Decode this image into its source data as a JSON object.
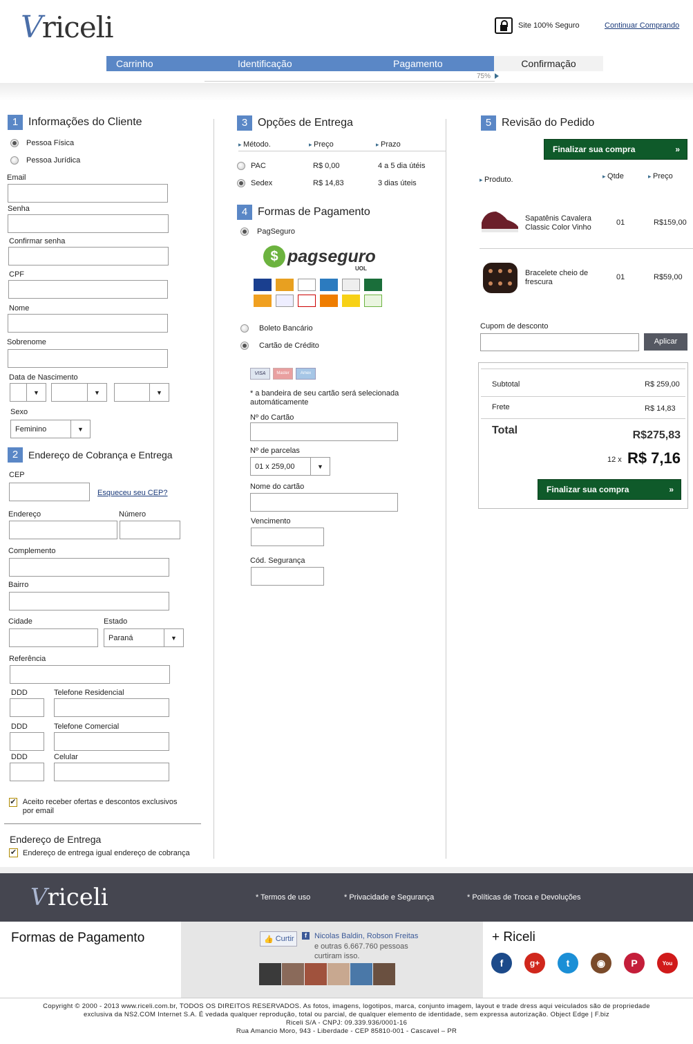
{
  "header": {
    "logo_text": "riceli",
    "secure_text": "Site 100% Seguro",
    "continue_link": "Continuar Comprando"
  },
  "steps": [
    "Carrinho",
    "Identificação",
    "Pagamento",
    "Confirmação"
  ],
  "progress": {
    "label": "75%",
    "value": 0.75
  },
  "client": {
    "num": "1",
    "title": "Informações do Cliente",
    "person_types": [
      "Pessoa Física",
      "Pessoa Jurídica"
    ],
    "person_selected": "Pessoa Física",
    "email": "Email",
    "password": "Senha",
    "confirm": "Confirmar senha",
    "cpf": "CPF",
    "name": "Nome",
    "surname": "Sobrenome",
    "birth": "Data de Nascimento",
    "sex": "Sexo",
    "sex_value": "Feminino"
  },
  "address": {
    "num": "2",
    "title": "Endereço de Cobrança e Entrega",
    "cep": "CEP",
    "forgot_cep": "Esqueceu seu CEP?",
    "street": "Endereço",
    "number": "Número",
    "complement": "Complemento",
    "district": "Bairro",
    "city": "Cidade",
    "state": "Estado",
    "state_value": "Paraná",
    "reference": "Referência",
    "ddd1": "DDD",
    "phone_home": "Telefone Residencial",
    "ddd2": "DDD",
    "phone_work": "Telefone Comercial",
    "ddd3": "DDD",
    "mobile": "Celular",
    "offers": "Aceito receber ofertas e descontos exclusivos por email",
    "delivery_title": "Endereço de Entrega",
    "delivery_same": "Endereço de entrega igual endereço de cobrança"
  },
  "shipping": {
    "num": "3",
    "title": "Opções de Entrega",
    "headers": [
      "Método.",
      "Preço",
      "Prazo"
    ],
    "rows": [
      {
        "method": "PAC",
        "price": "R$ 0,00",
        "time": "4 a 5 dia útéis",
        "selected": false
      },
      {
        "method": "Sedex",
        "price": "R$ 14,83",
        "time": "3 dias úteis",
        "selected": true
      }
    ]
  },
  "payment": {
    "num": "4",
    "title": "Formas de Pagamento",
    "options": [
      "PagSeguro",
      "Boleto Bancário",
      "Cartão de Crédito"
    ],
    "pagseguro_logo": "pagseguro",
    "pagseguro_sub": "UOL",
    "card_note": "* a bandeira de seu cartão será selecionada automáticamente",
    "card_number": "Nº do Cartão",
    "installments": "Nº de parcelas",
    "installments_value": "01 x 259,00",
    "card_name": "Nome do cartão",
    "expiry": "Vencimento",
    "cvv": "Cód. Segurança",
    "card_brands": [
      "VISA",
      "Master",
      "Amex"
    ]
  },
  "review": {
    "num": "5",
    "title": "Revisão do Pedido",
    "finish": "Finalizar sua compra",
    "headers": [
      "Produto.",
      "Qtde",
      "Preço"
    ],
    "items": [
      {
        "name": "Sapatênis Cavalera Classic Color Vinho",
        "qty": "01",
        "price": "R$159,00"
      },
      {
        "name": "Bracelete cheio de frescura",
        "qty": "01",
        "price": "R$59,00"
      }
    ],
    "coupon": "Cupom de desconto",
    "apply": "Aplicar",
    "subtotal_label": "Subtotal",
    "subtotal": "R$ 259,00",
    "shipping_label": "Frete",
    "shipping": "R$ 14,83",
    "total_label": "Total",
    "total": "R$275,83",
    "installment_prefix": "12 x",
    "installment_value": "R$ 7,16"
  },
  "footer": {
    "logo_text": "riceli",
    "links": [
      "* Termos de uso",
      "* Privacidade e Segurança",
      "* Políticas de Troca e Devoluções"
    ],
    "pay_title": "Formas de Pagamento",
    "fb_like": "Curtir",
    "fb_names": "Nicolas Baldin, Robson Freitas",
    "fb_rest": "e outras 6.667.760 pessoas curtiram isso.",
    "more": "+ Riceli",
    "social": [
      "facebook-icon",
      "google-plus-icon",
      "twitter-icon",
      "instagram-icon",
      "pinterest-icon",
      "youtube-icon"
    ],
    "copy1": "Copyright © 2000 - 2013 www.riceli.com.br, TODOS OS DIREITOS RESERVADOS. As fotos, imagens, logotipos, marca, conjunto imagem, layout e trade dress aqui veiculados são de propriedade",
    "copy2": "exclusiva da NS2.COM Internet S.A. É vedada qualquer reprodução, total ou parcial, de qualquer elemento de identidade, sem expressa autorização. Object Edge | F.biz",
    "copy3": "Riceli S/A - CNPJ: 09.339.936/0001-16",
    "copy4": "Rua Amancio Moro, 943 - Liberdade - CEP 85810-001 - Cascavel – PR"
  }
}
